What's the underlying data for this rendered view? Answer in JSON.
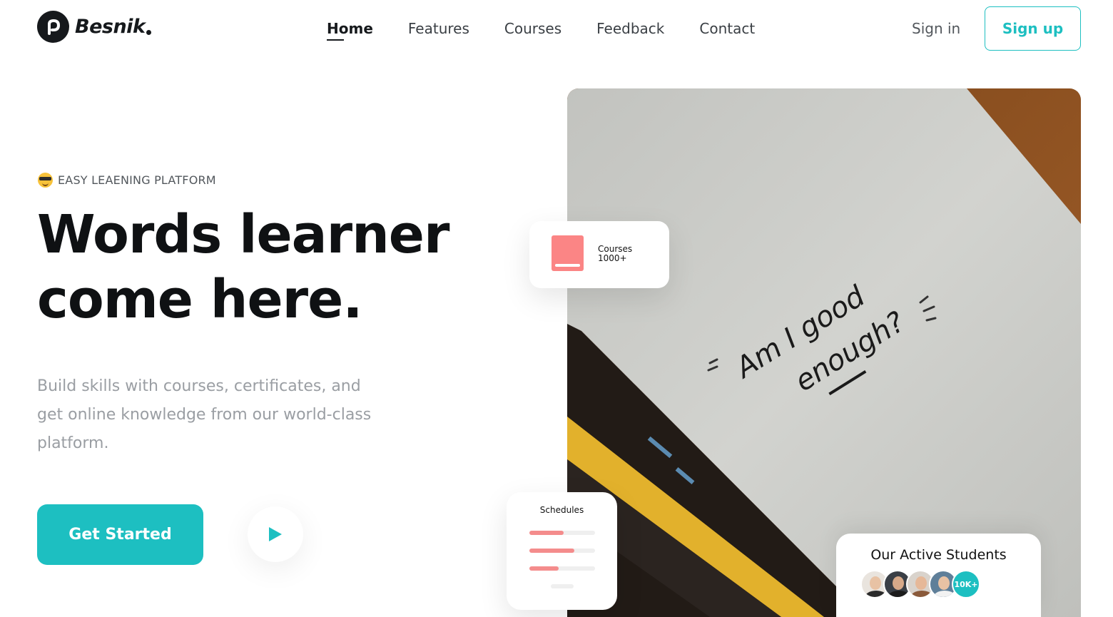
{
  "brand": {
    "name": "Besnik",
    "logo_icon": "p-letter-icon"
  },
  "nav": {
    "items": [
      {
        "label": "Home",
        "active": true
      },
      {
        "label": "Features",
        "active": false
      },
      {
        "label": "Courses",
        "active": false
      },
      {
        "label": "Feedback",
        "active": false
      },
      {
        "label": "Contact",
        "active": false
      }
    ],
    "signin_label": "Sign in",
    "signup_label": "Sign up"
  },
  "hero": {
    "tagline_icon": "sunglasses-emoji-icon",
    "tagline": "EASY LEAENING PLATFORM",
    "headline_line1": "Words learner",
    "headline_line2": "come here.",
    "subtitle": "Build skills with courses, certificates, and get online knowledge from our world-class platform.",
    "cta_label": "Get Started",
    "play_icon": "play-icon"
  },
  "image": {
    "handwriting_line1": "Am I good",
    "handwriting_line2": "enough?"
  },
  "cards": {
    "courses": {
      "label": "Courses",
      "count": "1000+",
      "icon": "book-icon"
    },
    "schedules": {
      "label": "Schedules",
      "progress": [
        0.52,
        0.68,
        0.45,
        0.0
      ]
    },
    "students": {
      "label": "Our Active Students",
      "count": "10K+"
    }
  },
  "colors": {
    "accent": "#1dbfc1",
    "dark": "#16191c",
    "coral": "#fb8585",
    "muted_text": "#9a9ea3"
  }
}
